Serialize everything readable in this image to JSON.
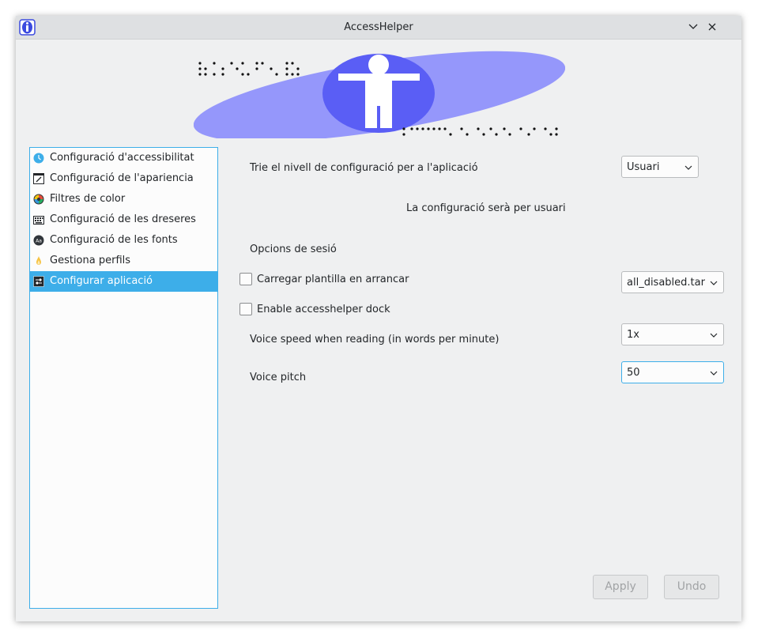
{
  "window": {
    "title": "AccessHelper"
  },
  "sidebar": {
    "items": [
      {
        "label": "Configuració d'accessibilitat",
        "icon": "clock-icon"
      },
      {
        "label": "Configuració de l'apariencia",
        "icon": "pen-icon"
      },
      {
        "label": "Filtres de color",
        "icon": "color-wheel-icon"
      },
      {
        "label": "Configuració de les dreseres",
        "icon": "keyboard-icon"
      },
      {
        "label": "Configuració de les fonts",
        "icon": "font-icon"
      },
      {
        "label": "Gestiona perfils",
        "icon": "flame-icon"
      },
      {
        "label": "Configurar aplicació",
        "icon": "settings-icon",
        "selected": true
      }
    ]
  },
  "main": {
    "level_label": "Trie el nivell de configuració per a l'aplicació",
    "level_select": "Usuari",
    "level_info": "La configuració serà per usuari",
    "session_heading": "Opcions de sesió",
    "load_template_label": "Carregar plantilla en arrancar",
    "load_template_checked": false,
    "template_select": "all_disabled.tar",
    "dock_label": "Enable accesshelper dock",
    "dock_checked": false,
    "voice_speed_label": "Voice speed when reading (in words per minute)",
    "voice_speed_select": "1x",
    "voice_pitch_label": "Voice pitch",
    "voice_pitch_select": "50"
  },
  "buttons": {
    "apply": "Apply",
    "undo": "Undo"
  },
  "colors": {
    "accent": "#3daee9",
    "banner_ellipse": "#9597fb",
    "banner_circle": "#5a5ef5"
  }
}
